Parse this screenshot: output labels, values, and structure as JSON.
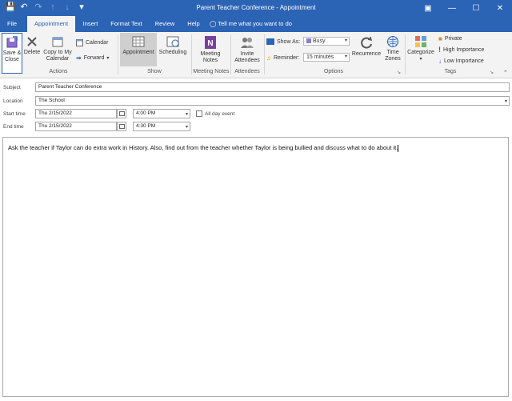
{
  "window": {
    "title": "Parent Teacher Conference  -  Appointment",
    "controls": [
      "restore-icon",
      "minimize-icon",
      "maximize-icon",
      "close-icon"
    ]
  },
  "quick_access": [
    "save-icon",
    "undo-icon",
    "redo-icon",
    "up-icon",
    "down-icon",
    "customize-icon"
  ],
  "tabs": [
    {
      "label": "File",
      "active": false
    },
    {
      "label": "Appointment",
      "active": true
    },
    {
      "label": "Insert",
      "active": false
    },
    {
      "label": "Format Text",
      "active": false
    },
    {
      "label": "Review",
      "active": false
    },
    {
      "label": "Help",
      "active": false
    }
  ],
  "tell_me": "Tell me what you want to do",
  "ribbon": {
    "actions": {
      "save_close": "Save &\nClose",
      "delete": "Delete",
      "copy_calendar": "Copy to My\nCalendar",
      "calendar": "Calendar",
      "forward": "Forward",
      "group": "Actions"
    },
    "show": {
      "appointment": "Appointment",
      "scheduling": "Scheduling",
      "group": "Show"
    },
    "meeting_notes": {
      "label": "Meeting\nNotes",
      "group": "Meeting Notes"
    },
    "attendees": {
      "label": "Invite\nAttendees",
      "group": "Attendees"
    },
    "options": {
      "show_as_label": "Show As:",
      "show_as_value": "Busy",
      "reminder_label": "Reminder:",
      "reminder_value": "15 minutes",
      "recurrence": "Recurrence",
      "time_zones": "Time\nZones",
      "group": "Options"
    },
    "tags": {
      "categorize": "Categorize",
      "private": "Private",
      "high": "High Importance",
      "low": "Low Importance",
      "group": "Tags"
    }
  },
  "form": {
    "subject_label": "Subject",
    "subject_value": "Parent Teacher Conference",
    "location_label": "Location",
    "location_value": "The School",
    "start_label": "Start time",
    "start_date": "Thu 2/15/2022",
    "start_time": "4:00 PM",
    "all_day": "All day event",
    "end_label": "End time",
    "end_date": "Thu 2/15/2022",
    "end_time": "4:30 PM"
  },
  "body": "Ask the teacher if Taylor can do extra work in History. Also, find out from the teacher whether Taylor is being bullied and discuss what to do about it.",
  "colors": {
    "accent": "#2b63b5",
    "ribbon_bg": "#f3f3f3",
    "busy": "#8a7dd0"
  }
}
